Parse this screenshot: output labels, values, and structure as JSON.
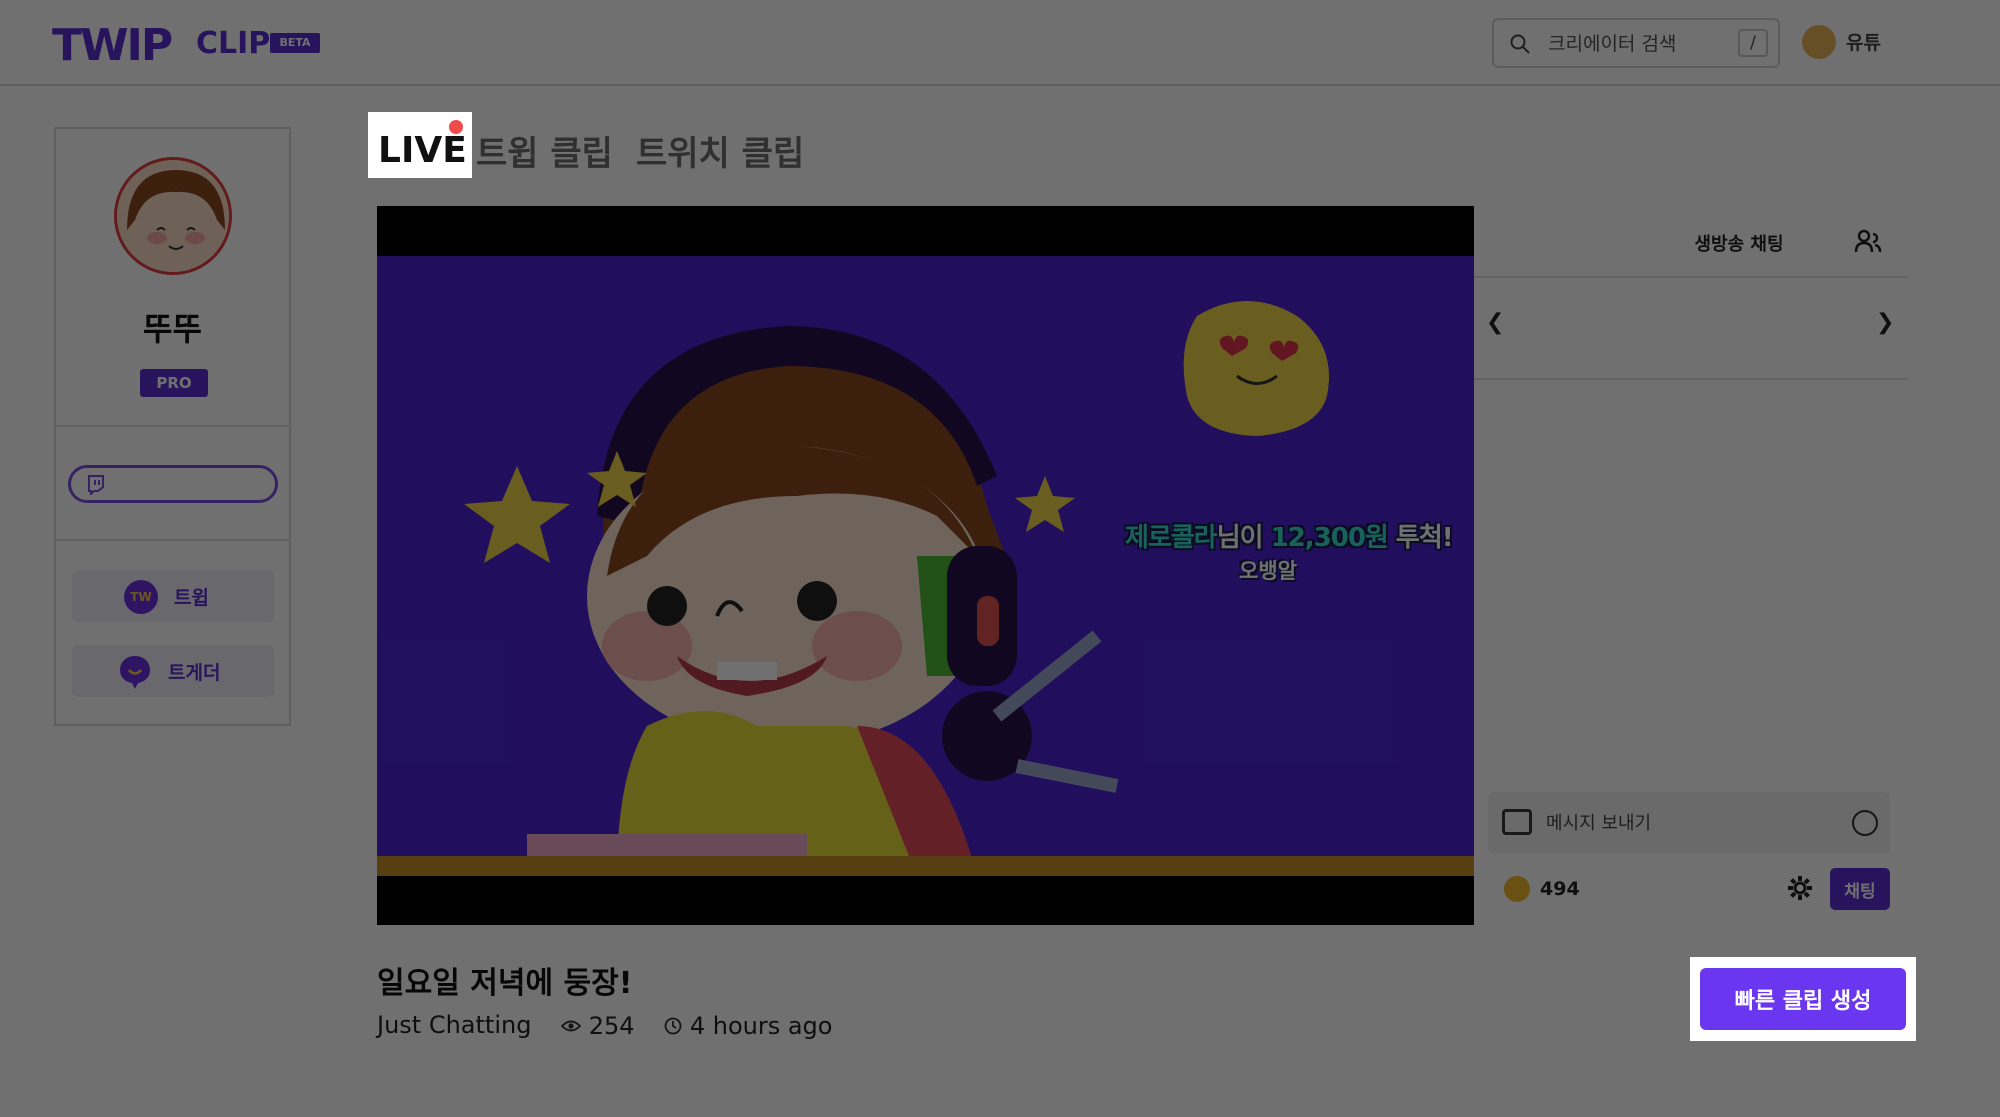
{
  "header": {
    "logo_main": "TWIP",
    "logo_sub": "CLIP",
    "logo_badge": "BETA",
    "search_placeholder": "크리에이터 검색",
    "search_shortcut": "/",
    "user_name": "유튜"
  },
  "profile": {
    "name": "뚜뚜",
    "badge": "PRO",
    "links": [
      {
        "label": "트윕",
        "icon": "twip-icon",
        "icon_text": "TW"
      },
      {
        "label": "트게더",
        "icon": "tgd-icon"
      }
    ]
  },
  "tabs": {
    "live": "LIVE",
    "twip_clips": "트윕 클립",
    "twitch_clips": "트위치 클립"
  },
  "video": {
    "donation_name": "제로콜라",
    "donation_mid": "님이 ",
    "donation_amount": "12,300원",
    "donation_end": " 투척!",
    "donation_message": "오뱅알"
  },
  "chat": {
    "title": "생방송 채팅",
    "message_placeholder": "메시지 보내기",
    "points": "494",
    "send_label": "채팅"
  },
  "clip": {
    "title": "일요일 저녁에 둥장!",
    "category": "Just Chatting",
    "views": "254",
    "time_ago": "4 hours ago"
  },
  "actions": {
    "quick_clip": "빠른 클립 생성"
  },
  "colors": {
    "brand": "#5a2ed1",
    "button": "#6a36ef",
    "live_dot": "#ef4b4b",
    "video_bg": "#4b24d6"
  }
}
